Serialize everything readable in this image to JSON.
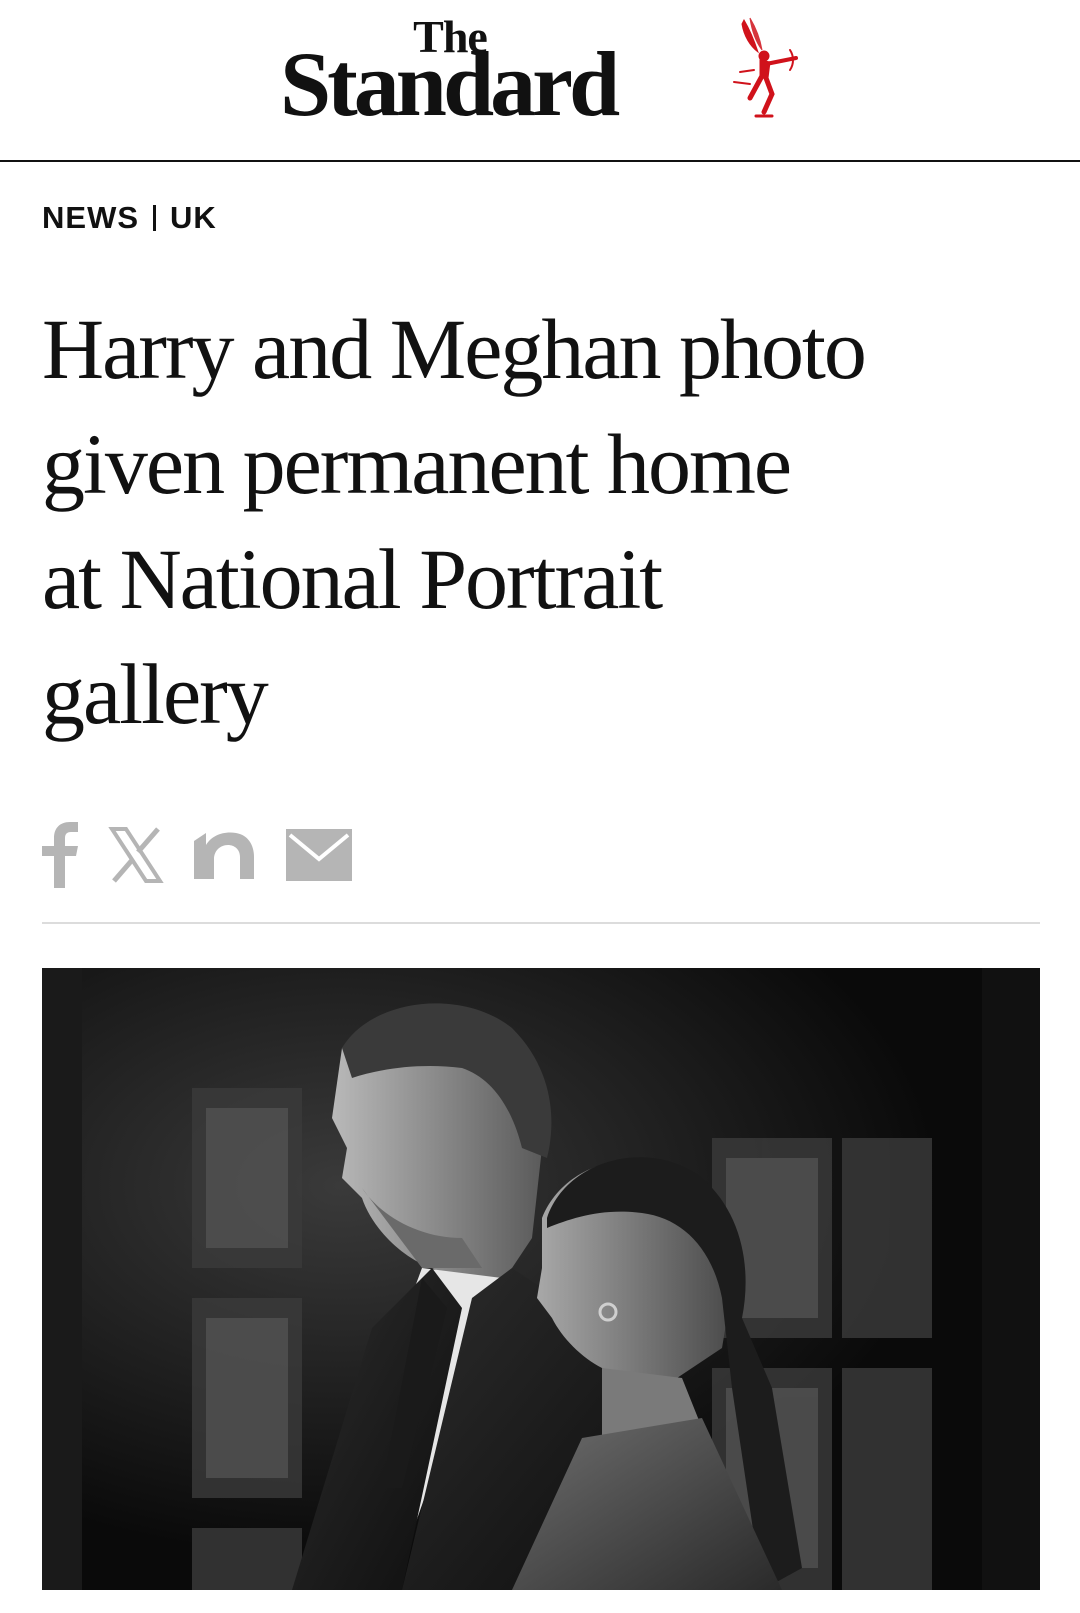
{
  "masthead": {
    "the": "The",
    "name": "Standard",
    "logo_icon": "eros-statue-icon",
    "logo_color": "#d0121b"
  },
  "section": {
    "category": "NEWS",
    "subcategory": "UK"
  },
  "article": {
    "headline_lines": [
      "Harry and Meghan photo",
      "given permanent home",
      "at National Portrait",
      "gallery"
    ]
  },
  "share": {
    "icons": [
      "facebook-icon",
      "x-icon",
      "newsnow-icon",
      "email-icon"
    ],
    "icon_color": "#b5b5b5"
  },
  "hero_image": {
    "description_icon": "photo",
    "tone": "black-and-white"
  }
}
